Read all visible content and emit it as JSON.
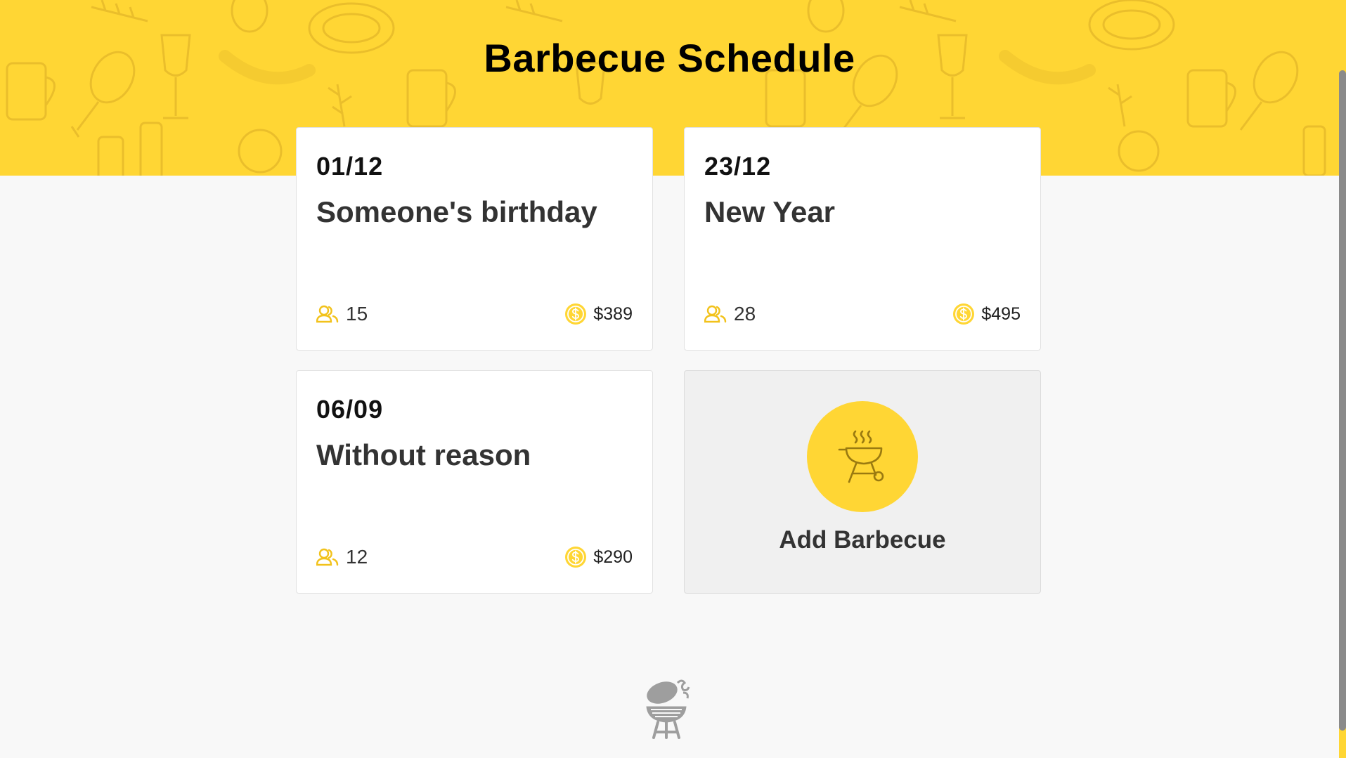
{
  "header": {
    "title": "Barbecue Schedule",
    "background_color": "#ffd634"
  },
  "events": [
    {
      "date": "01/12",
      "title": "Someone's birthday",
      "people": "15",
      "price": "$389"
    },
    {
      "date": "23/12",
      "title": "New Year",
      "people": "28",
      "price": "$495"
    },
    {
      "date": "06/09",
      "title": "Without reason",
      "people": "12",
      "price": "$290"
    }
  ],
  "add_card": {
    "label": "Add Barbecue",
    "icon": "grill-icon"
  },
  "icons": {
    "people": "people-icon",
    "price": "dollar-coin-icon",
    "footer": "barbecue-logo-icon"
  },
  "colors": {
    "accent": "#ffd634",
    "card_bg": "#ffffff",
    "add_card_bg": "#f0f0f0",
    "page_bg": "#f8f8f8"
  }
}
